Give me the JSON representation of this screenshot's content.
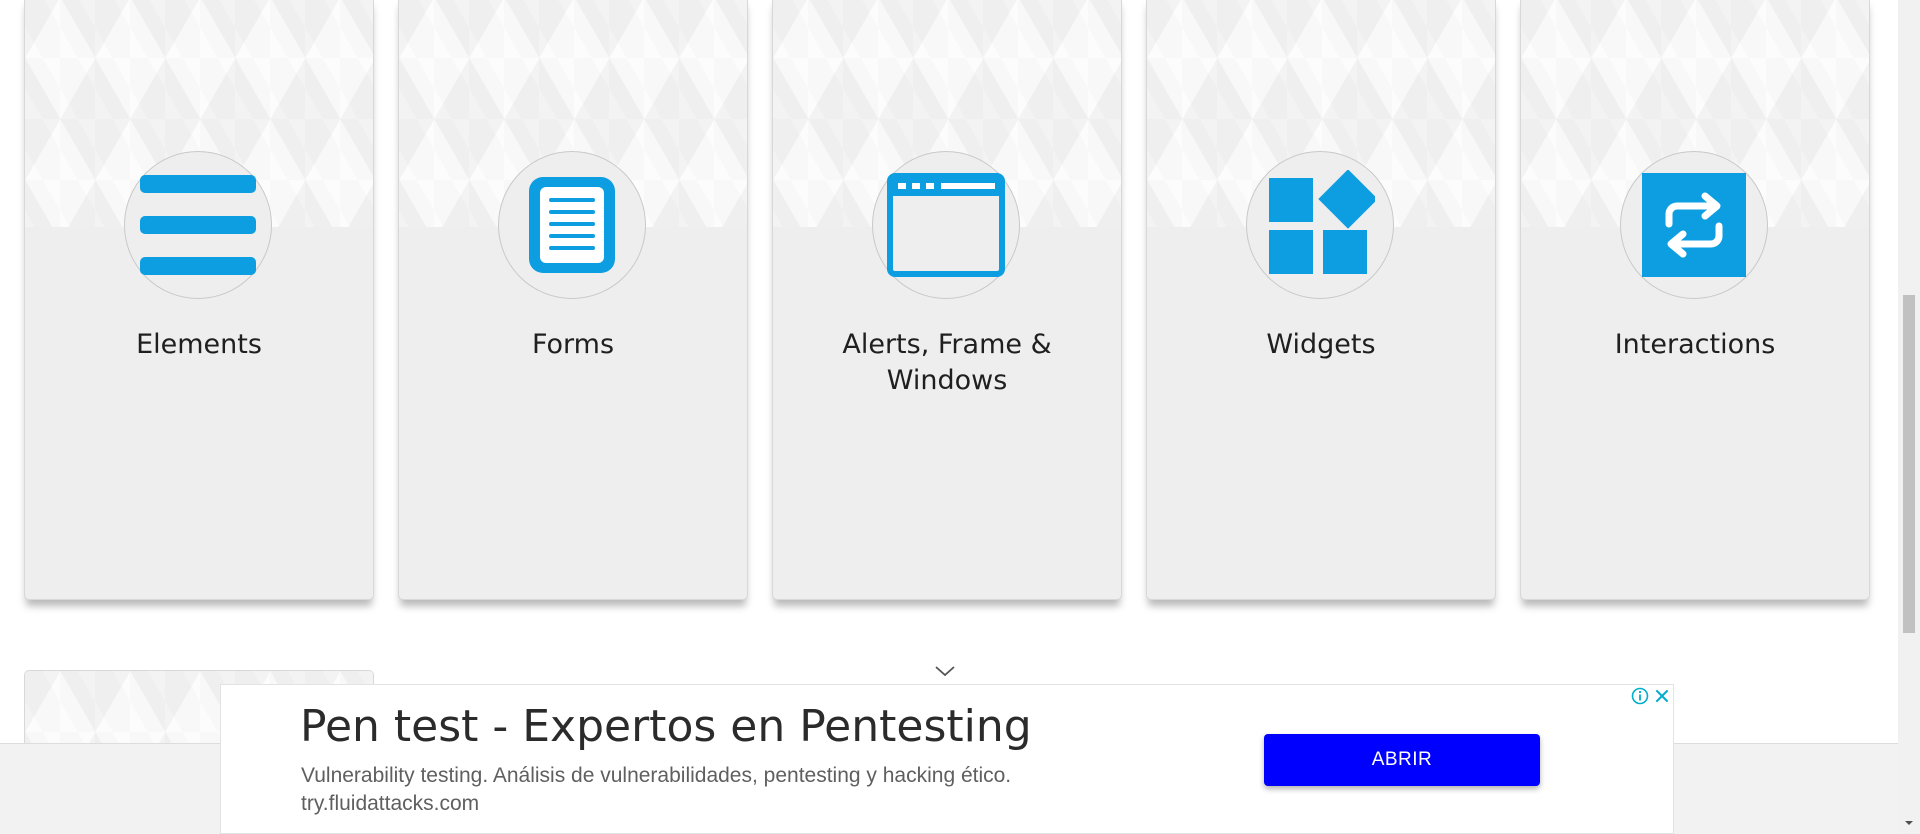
{
  "cards": [
    {
      "title": "Elements",
      "icon": "hamburger-menu-icon"
    },
    {
      "title": "Forms",
      "icon": "document-form-icon"
    },
    {
      "title": "Alerts, Frame & Windows",
      "icon": "browser-window-icon"
    },
    {
      "title": "Widgets",
      "icon": "widgets-blocks-icon"
    },
    {
      "title": "Interactions",
      "icon": "repeat-arrows-icon"
    }
  ],
  "colors": {
    "icon_accent": "#0d9ee2",
    "card_bg": "#eeeeee",
    "ad_button": "#0000ff"
  },
  "ad": {
    "title": "Pen test - Expertos en Pentesting",
    "description": "Vulnerability testing. Análisis de vulnerabilidades, pentesting y hacking ético.",
    "url": "try.fluidattacks.com",
    "button_label": "ABRIR",
    "info_icon": "info-icon",
    "close_icon": "close-icon"
  },
  "scroll": {
    "more_indicator_icon": "chevron-down-icon"
  }
}
